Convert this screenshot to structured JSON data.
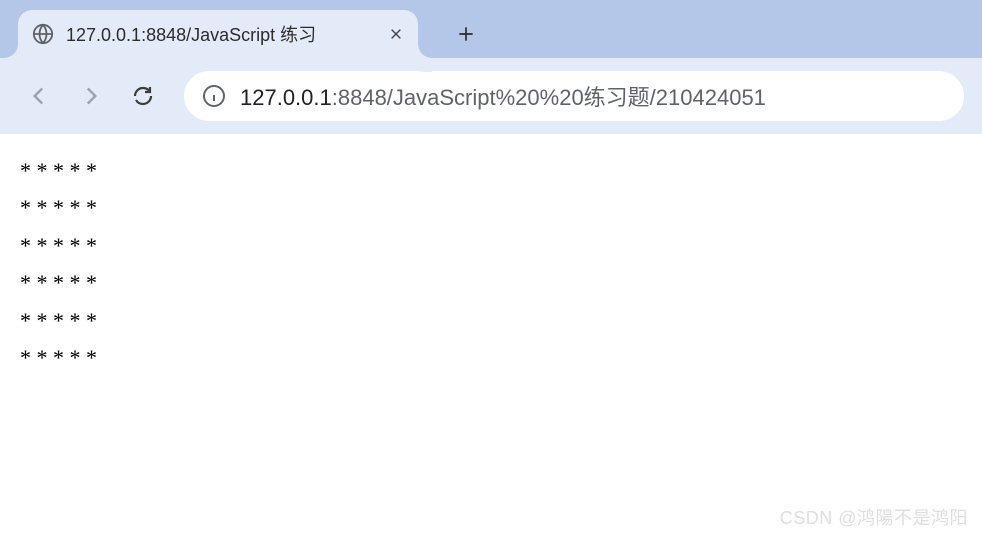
{
  "tab": {
    "title": "127.0.0.1:8848/JavaScript  练习"
  },
  "url": {
    "host": "127.0.0.1",
    "rest": ":8848/JavaScript%20%20练习题/210424051"
  },
  "page": {
    "rows": [
      "* * * * *",
      "* * * * *",
      "* * * * *",
      "* * * * *",
      "* * * * *",
      "* * * * *"
    ]
  },
  "watermark": "CSDN @鸿陽不是鸿阳"
}
